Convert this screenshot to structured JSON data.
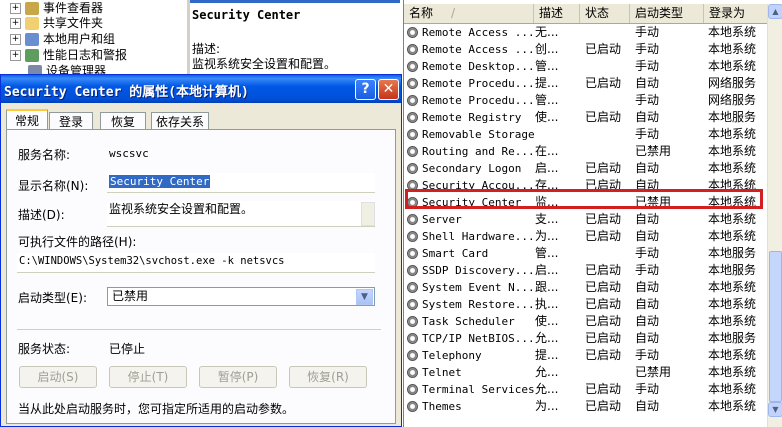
{
  "tree": {
    "items": [
      {
        "label": "事件查看器",
        "expander": "+"
      },
      {
        "label": "共享文件夹",
        "expander": "+"
      },
      {
        "label": "本地用户和组",
        "expander": "+"
      },
      {
        "label": "性能日志和警报",
        "expander": "+"
      },
      {
        "label": "设备管理器",
        "expander": ""
      }
    ]
  },
  "description_panel": {
    "title": "Security Center",
    "label": "描述:",
    "text": "监视系统安全设置和配置。"
  },
  "services": {
    "columns": [
      "名称",
      "描述",
      "状态",
      "启动类型",
      "登录为"
    ],
    "sort_indicator": "/",
    "rows": [
      {
        "name": "Remote Access ...",
        "desc": "无...",
        "status": "",
        "startup": "手动",
        "logon": "本地系统"
      },
      {
        "name": "Remote Access ...",
        "desc": "创...",
        "status": "已启动",
        "startup": "手动",
        "logon": "本地系统"
      },
      {
        "name": "Remote Desktop...",
        "desc": "管...",
        "status": "",
        "startup": "手动",
        "logon": "本地系统"
      },
      {
        "name": "Remote Procedu...",
        "desc": "提...",
        "status": "已启动",
        "startup": "自动",
        "logon": "网络服务"
      },
      {
        "name": "Remote Procedu...",
        "desc": "管...",
        "status": "",
        "startup": "手动",
        "logon": "网络服务"
      },
      {
        "name": "Remote Registry",
        "desc": "使...",
        "status": "已启动",
        "startup": "自动",
        "logon": "本地服务"
      },
      {
        "name": "Removable Storage",
        "desc": "",
        "status": "",
        "startup": "手动",
        "logon": "本地系统"
      },
      {
        "name": "Routing and Re...",
        "desc": "在...",
        "status": "",
        "startup": "已禁用",
        "logon": "本地系统"
      },
      {
        "name": "Secondary Logon",
        "desc": "启...",
        "status": "已启动",
        "startup": "自动",
        "logon": "本地系统"
      },
      {
        "name": "Security Accou...",
        "desc": "存...",
        "status": "已启动",
        "startup": "自动",
        "logon": "本地系统"
      },
      {
        "name": "Security Center",
        "desc": "监...",
        "status": "",
        "startup": "已禁用",
        "logon": "本地系统"
      },
      {
        "name": "Server",
        "desc": "支...",
        "status": "已启动",
        "startup": "自动",
        "logon": "本地系统"
      },
      {
        "name": "Shell Hardware...",
        "desc": "为...",
        "status": "已启动",
        "startup": "自动",
        "logon": "本地系统"
      },
      {
        "name": "Smart Card",
        "desc": "管...",
        "status": "",
        "startup": "手动",
        "logon": "本地服务"
      },
      {
        "name": "SSDP Discovery...",
        "desc": "启...",
        "status": "已启动",
        "startup": "手动",
        "logon": "本地服务"
      },
      {
        "name": "System Event N...",
        "desc": "跟...",
        "status": "已启动",
        "startup": "自动",
        "logon": "本地系统"
      },
      {
        "name": "System Restore...",
        "desc": "执...",
        "status": "已启动",
        "startup": "自动",
        "logon": "本地系统"
      },
      {
        "name": "Task Scheduler",
        "desc": "使...",
        "status": "已启动",
        "startup": "自动",
        "logon": "本地系统"
      },
      {
        "name": "TCP/IP NetBIOS...",
        "desc": "允...",
        "status": "已启动",
        "startup": "自动",
        "logon": "本地服务"
      },
      {
        "name": "Telephony",
        "desc": "提...",
        "status": "已启动",
        "startup": "手动",
        "logon": "本地系统"
      },
      {
        "name": "Telnet",
        "desc": "允...",
        "status": "",
        "startup": "已禁用",
        "logon": "本地系统"
      },
      {
        "name": "Terminal Services",
        "desc": "允...",
        "status": "已启动",
        "startup": "手动",
        "logon": "本地系统"
      },
      {
        "name": "Themes",
        "desc": "为...",
        "status": "已启动",
        "startup": "自动",
        "logon": "本地系统"
      }
    ]
  },
  "dialog": {
    "title": "Security Center 的属性(本地计算机)",
    "help_label": "?",
    "close_label": "✕",
    "tabs": [
      "常规",
      "登录",
      "恢复",
      "依存关系"
    ],
    "service_name_label": "服务名称:",
    "service_name": "wscsvc",
    "display_name_label": "显示名称(N):",
    "display_name": "Security Center",
    "description_label": "描述(D):",
    "description": "监视系统安全设置和配置。",
    "exe_path_label": "可执行文件的路径(H):",
    "exe_path": "C:\\WINDOWS\\System32\\svchost.exe -k netsvcs",
    "startup_type_label": "启动类型(E):",
    "startup_type": "已禁用",
    "status_label": "服务状态:",
    "status": "已停止",
    "buttons": {
      "start": "启动(S)",
      "stop": "停止(T)",
      "pause": "暂停(P)",
      "resume": "恢复(R)"
    },
    "hint": "当从此处启动服务时，您可指定所适用的启动参数。"
  }
}
